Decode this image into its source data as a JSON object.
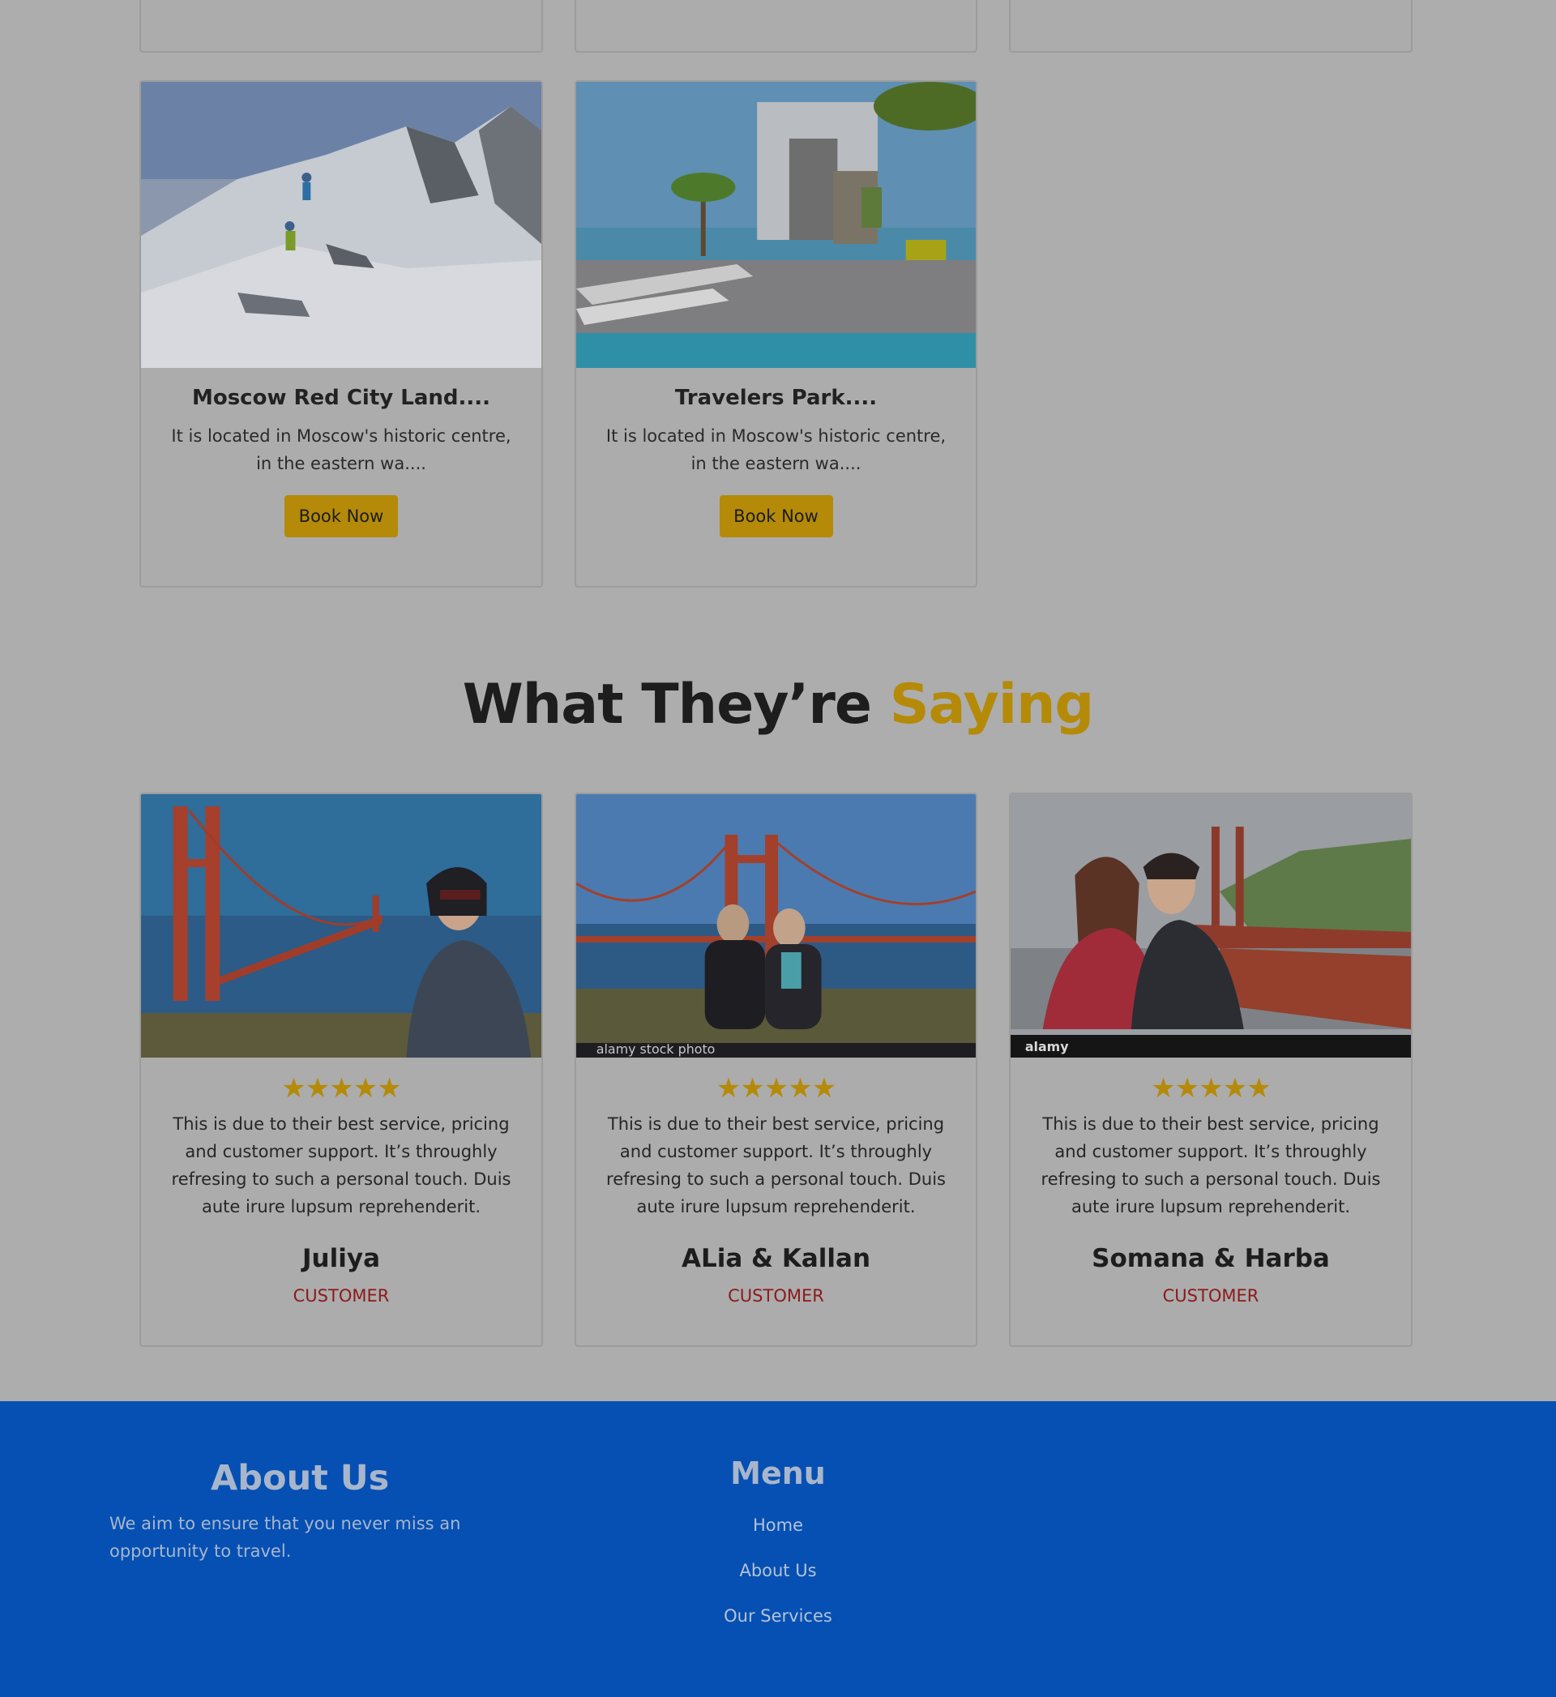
{
  "top_cards": [
    {
      "button_label": ""
    },
    {
      "button_label": ""
    },
    {
      "button_label": ""
    }
  ],
  "destinations": [
    {
      "title": "Moscow Red City Land....",
      "description": "It is located in Moscow's historic centre, in the eastern wa....",
      "button_label": "Book Now",
      "image": "snowy-mountain-climbers"
    },
    {
      "title": "Travelers Park....",
      "description": "It is located in Moscow's historic centre, in the eastern wa....",
      "button_label": "Book Now",
      "image": "resort-pool-terrace"
    }
  ],
  "testimonials_heading": {
    "main": "What They’re",
    "accent": "Saying",
    "accent_color": "#b48a08"
  },
  "testimonials": [
    {
      "stars": 5,
      "text": "This is due to their best service, pricing and customer support. It’s throughly refresing to such a personal touch. Duis aute irure lupsum reprehenderit.",
      "name": "Juliya",
      "role": "CUSTOMER",
      "image": "woman-golden-gate-bridge"
    },
    {
      "stars": 5,
      "text": "This is due to their best service, pricing and customer support. It’s throughly refresing to such a personal touch. Duis aute irure lupsum reprehenderit.",
      "name": "ALia & Kallan",
      "role": "CUSTOMER",
      "image": "couple-golden-gate-bridge",
      "watermark": "alamy stock photo"
    },
    {
      "stars": 5,
      "text": "This is due to their best service, pricing and customer support. It’s throughly refresing to such a personal touch. Duis aute irure lupsum reprehenderit.",
      "name": "Somana & Harba",
      "role": "CUSTOMER",
      "image": "couple-bridge-hills",
      "watermark": "alamy"
    }
  ],
  "footer": {
    "about_title": "About Us",
    "about_text": "We aim to ensure that you never miss an opportunity to travel.",
    "menu_title": "Menu",
    "menu_links": [
      "Home",
      "About Us",
      "Our Services"
    ],
    "background": "#0650b3"
  }
}
